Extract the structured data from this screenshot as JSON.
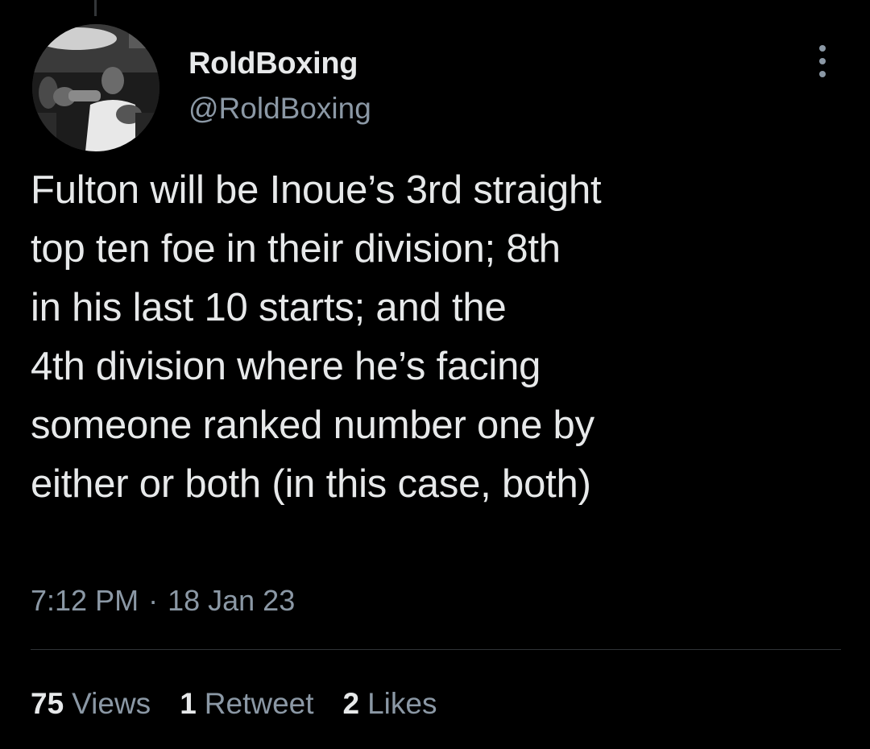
{
  "tweet": {
    "author": {
      "display_name": "RoldBoxing",
      "handle": "@RoldBoxing",
      "avatar": "boxer-photo-avatar"
    },
    "text": "Fulton will be Inoue’s 3rd straight\ntop ten foe in their division; 8th\nin his last 10 starts; and the\n4th division where he’s facing\nsomeone ranked number one by\neither or both (in this case, both)",
    "time": "7:12 PM",
    "separator": "·",
    "date": "18 Jan 23",
    "more_icon": "more-options-icon",
    "stats": {
      "views_count": "75",
      "views_label": "Views",
      "retweets_count": "1",
      "retweets_label": "Retweet",
      "likes_count": "2",
      "likes_label": "Likes"
    }
  },
  "colors": {
    "background": "#000000",
    "primary_text": "#e7e9ea",
    "secondary_text": "#8b98a5",
    "divider": "#2f3336"
  }
}
